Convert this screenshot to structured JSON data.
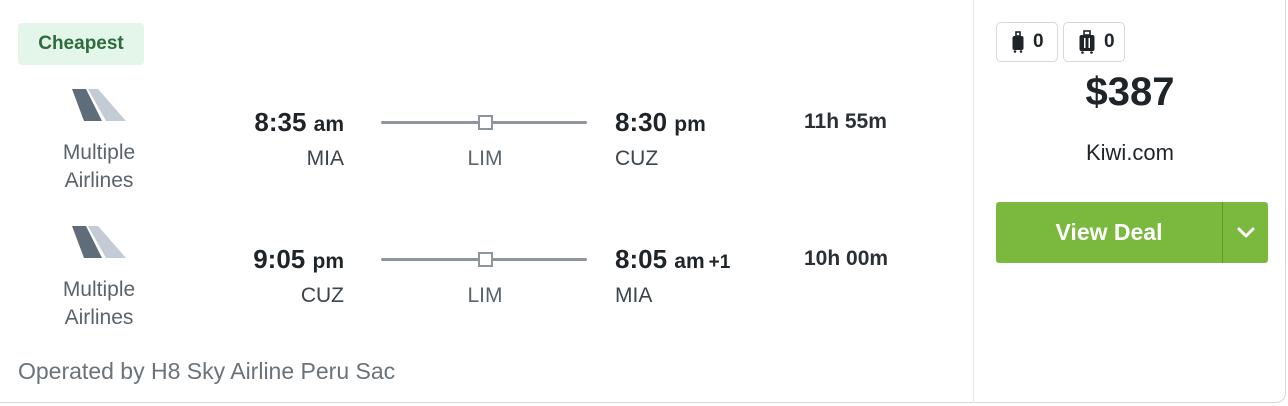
{
  "badge": "Cheapest",
  "legs": [
    {
      "airline_line1": "Multiple",
      "airline_line2": "Airlines",
      "depart_time": "8:35",
      "depart_ampm": "am",
      "depart_code": "MIA",
      "stop_code": "LIM",
      "arrive_time": "8:30",
      "arrive_ampm": "pm",
      "arrive_plus": "",
      "arrive_code": "CUZ",
      "duration": "11h 55m"
    },
    {
      "airline_line1": "Multiple",
      "airline_line2": "Airlines",
      "depart_time": "9:05",
      "depart_ampm": "pm",
      "depart_code": "CUZ",
      "stop_code": "LIM",
      "arrive_time": "8:05",
      "arrive_ampm": "am",
      "arrive_plus": "+1",
      "arrive_code": "MIA",
      "duration": "10h 00m"
    }
  ],
  "operated_by": "Operated by H8 Sky Airline Peru Sac",
  "bags": {
    "carry_on": {
      "icon": "carry-on-bag-icon",
      "count": "0"
    },
    "checked": {
      "icon": "checked-bag-icon",
      "count": "0"
    }
  },
  "price": "$387",
  "provider": "Kiwi.com",
  "deal_button": "View Deal",
  "colors": {
    "accent": "#7ab83e",
    "badge_bg": "#e3f6e9",
    "badge_text": "#2e6b3f"
  }
}
